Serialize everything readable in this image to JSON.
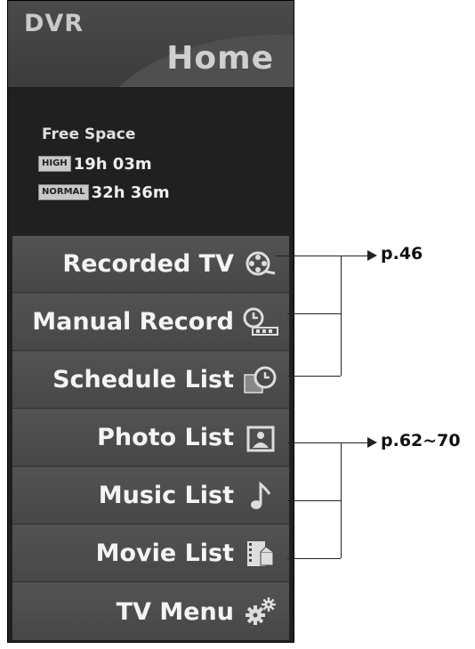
{
  "header": {
    "app_label": "DVR",
    "title": "Home"
  },
  "free_space": {
    "title": "Free Space",
    "rows": [
      {
        "badge": "HIGH",
        "value": "19h 03m"
      },
      {
        "badge": "NORMAL",
        "value": "32h 36m"
      }
    ]
  },
  "menu": {
    "items": [
      {
        "label": "Recorded TV",
        "icon": "film-reel-icon"
      },
      {
        "label": "Manual Record",
        "icon": "clock-record-icon"
      },
      {
        "label": "Schedule List",
        "icon": "schedule-clock-icon"
      },
      {
        "label": "Photo List",
        "icon": "photo-icon"
      },
      {
        "label": "Music List",
        "icon": "music-note-icon"
      },
      {
        "label": "Movie List",
        "icon": "movie-clapper-icon"
      },
      {
        "label": "TV Menu",
        "icon": "gears-icon"
      }
    ]
  },
  "references": {
    "group1": "p.46",
    "group2": "p.62~70"
  }
}
